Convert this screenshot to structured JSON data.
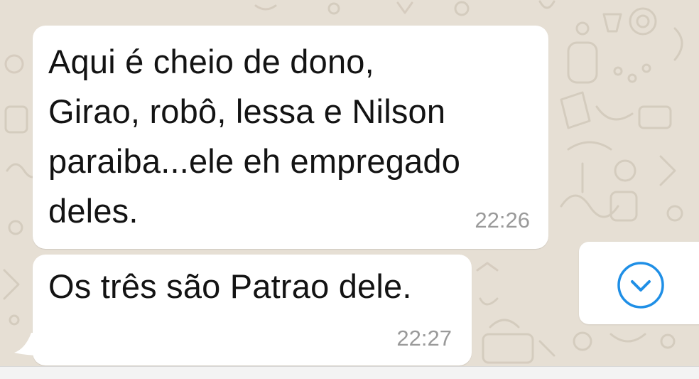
{
  "conversation": {
    "messages": [
      {
        "direction": "incoming",
        "text": "Aqui é cheio de dono,\nGirao, robô, lessa e Nilson\nparaiba...ele eh empregado\ndeles.",
        "time": "22:26"
      },
      {
        "direction": "incoming",
        "text": "Os três são Patrao dele.",
        "time": "22:27"
      }
    ],
    "scroll_down_icon": "chevron-down-circle-icon"
  },
  "colors": {
    "background": "#e6dfd4",
    "bubble": "#ffffff",
    "timestamp": "#9a9a9a",
    "accent": "#1f8fe6"
  }
}
